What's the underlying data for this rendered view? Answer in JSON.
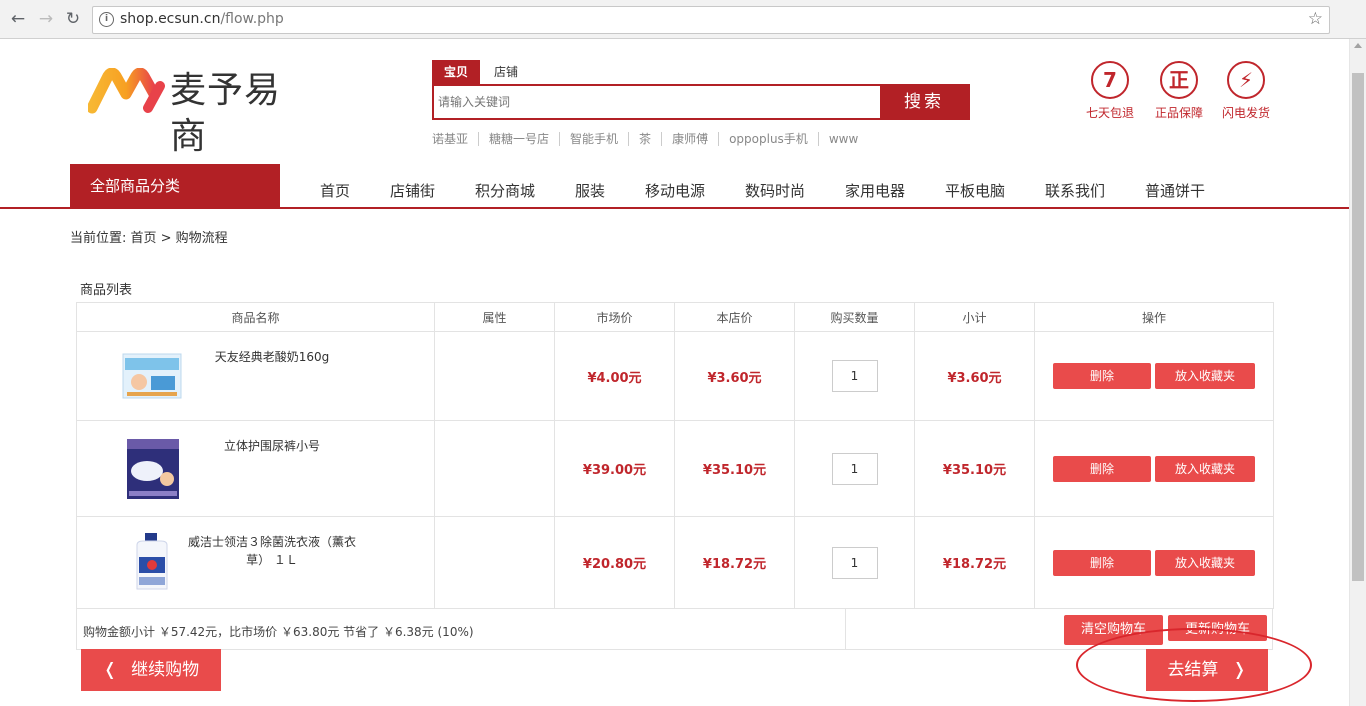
{
  "browser": {
    "url_host": "shop.ecsun.cn",
    "url_path": "/flow.php"
  },
  "header": {
    "logo_text": "麦予易商",
    "search_tabs": [
      "宝贝",
      "店铺"
    ],
    "search_placeholder": "请输入关键词",
    "search_button": "搜索",
    "hot_words": [
      "诺基亚",
      "糖糖一号店",
      "智能手机",
      "茶",
      "康师傅",
      "oppoplus手机",
      "www"
    ],
    "features": [
      {
        "symbol": "7",
        "label": "七天包退"
      },
      {
        "symbol": "正",
        "label": "正品保障"
      },
      {
        "symbol": "⚡",
        "label": "闪电发货"
      }
    ]
  },
  "nav": {
    "all_categories": "全部商品分类",
    "items": [
      "首页",
      "店铺街",
      "积分商城",
      "服装",
      "移动电源",
      "数码时尚",
      "家用电器",
      "平板电脑",
      "联系我们",
      "普通饼干"
    ]
  },
  "breadcrumb": "当前位置: 首页 > 购物流程",
  "cart": {
    "title": "商品列表",
    "columns": [
      "商品名称",
      "属性",
      "市场价",
      "本店价",
      "购买数量",
      "小计",
      "操作"
    ],
    "rows": [
      {
        "name": "天友经典老酸奶160g",
        "attr": "",
        "market": "¥4.00元",
        "shop": "¥3.60元",
        "qty": "1",
        "subtotal": "¥3.60元"
      },
      {
        "name": "立体护围尿裤小号",
        "attr": "",
        "market": "¥39.00元",
        "shop": "¥35.10元",
        "qty": "1",
        "subtotal": "¥35.10元"
      },
      {
        "name": "威洁士领洁３除菌洗衣液（薰衣草） １Ｌ",
        "attr": "",
        "market": "¥20.80元",
        "shop": "¥18.72元",
        "qty": "1",
        "subtotal": "¥18.72元"
      }
    ],
    "delete_label": "删除",
    "favorite_label": "放入收藏夹",
    "summary": "购物金额小计 ￥57.42元，比市场价 ￥63.80元 节省了 ￥6.38元 (10%)",
    "clear_label": "清空购物车",
    "update_label": "更新购物车",
    "continue_label": "继续购物",
    "checkout_label": "去结算"
  }
}
